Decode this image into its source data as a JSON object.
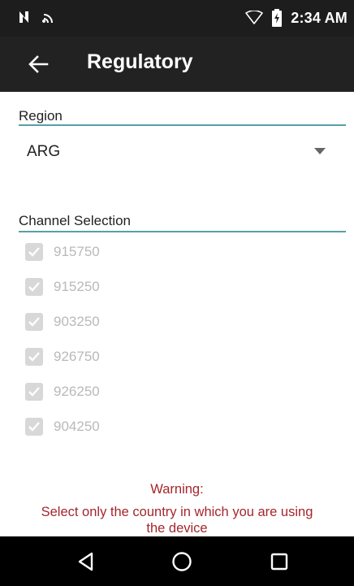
{
  "status_bar": {
    "time": "2:34 AM",
    "icons": [
      "nfc-icon",
      "cast-icon",
      "wifi-icon",
      "battery-charging-icon"
    ]
  },
  "app_bar": {
    "title": "Regulatory",
    "back_icon": "back-arrow-icon"
  },
  "region": {
    "label": "Region",
    "value": "ARG"
  },
  "channel_selection": {
    "label": "Channel Selection",
    "channels": [
      {
        "value": "915750",
        "checked": true
      },
      {
        "value": "915250",
        "checked": true
      },
      {
        "value": "903250",
        "checked": true
      },
      {
        "value": "926750",
        "checked": true
      },
      {
        "value": "926250",
        "checked": true
      },
      {
        "value": "904250",
        "checked": true
      }
    ]
  },
  "warning": {
    "line1": "Warning:",
    "line2": "Select only the country in which you are using",
    "line3": "the device"
  },
  "colors": {
    "accent_line": "#55a0a8",
    "warning_text": "#a4262c",
    "app_bar": "#222222",
    "status_bar": "#1d1d1d"
  }
}
